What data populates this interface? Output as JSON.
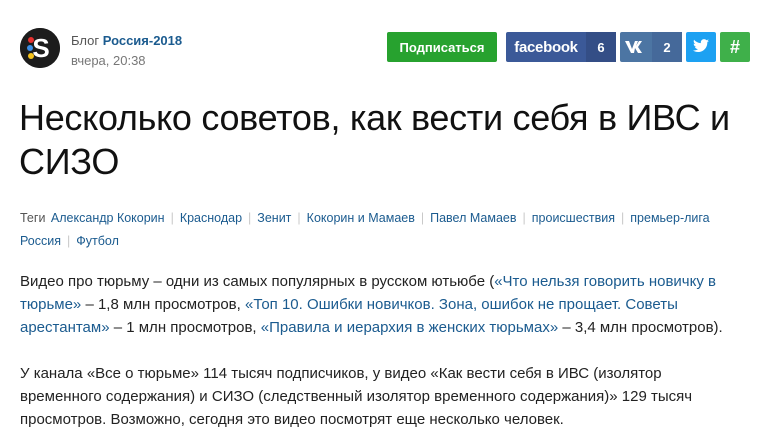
{
  "header": {
    "blog_label": "Блог",
    "blog_name": "Россия-2018",
    "time": "вчера, 20:38",
    "subscribe_label": "Подписаться",
    "facebook_label": "facebook",
    "facebook_count": "6",
    "vk_count": "2",
    "hash_label": "#"
  },
  "article": {
    "title": "Несколько советов, как вести себя в ИВС и СИЗО",
    "tags_label": "Теги",
    "tags": [
      "Александр Кокорин",
      "Краснодар",
      "Зенит",
      "Кокорин и Мамаев",
      "Павел Мамаев",
      "происшествия",
      "премьер-лига Россия",
      "Футбол"
    ],
    "p1": {
      "t0": "Видео про тюрьму – одни из самых популярных в русском ютьюбе (",
      "l1": "«Что нельзя говорить новичку в тюрьме»",
      "t1": " – 1,8 млн просмотров, ",
      "l2": "«Топ 10. Ошибки новичков. Зона, ошибок не прощает. Советы арестантам»",
      "t2": " – 1 млн просмотров, ",
      "l3": "«Правила и иерархия в женских тюрьмах»",
      "t3": " – 3,4 млн просмотров)."
    },
    "p2": "У канала «Все о тюрьме» 114 тысяч подписчиков, у видео «Как вести себя в ИВС (изолятор временного содержания) и СИЗО (следственный изолятор временного содержания)» 129 тысяч просмотров. Возможно, сегодня это видео посмотрят еще несколько человек."
  },
  "colors": {
    "link": "#1b5b8f",
    "subscribe": "#27a22f",
    "facebook": "#3b5998",
    "vk": "#4c75a3",
    "twitter": "#1da1f2",
    "hash": "#3fb04a"
  }
}
